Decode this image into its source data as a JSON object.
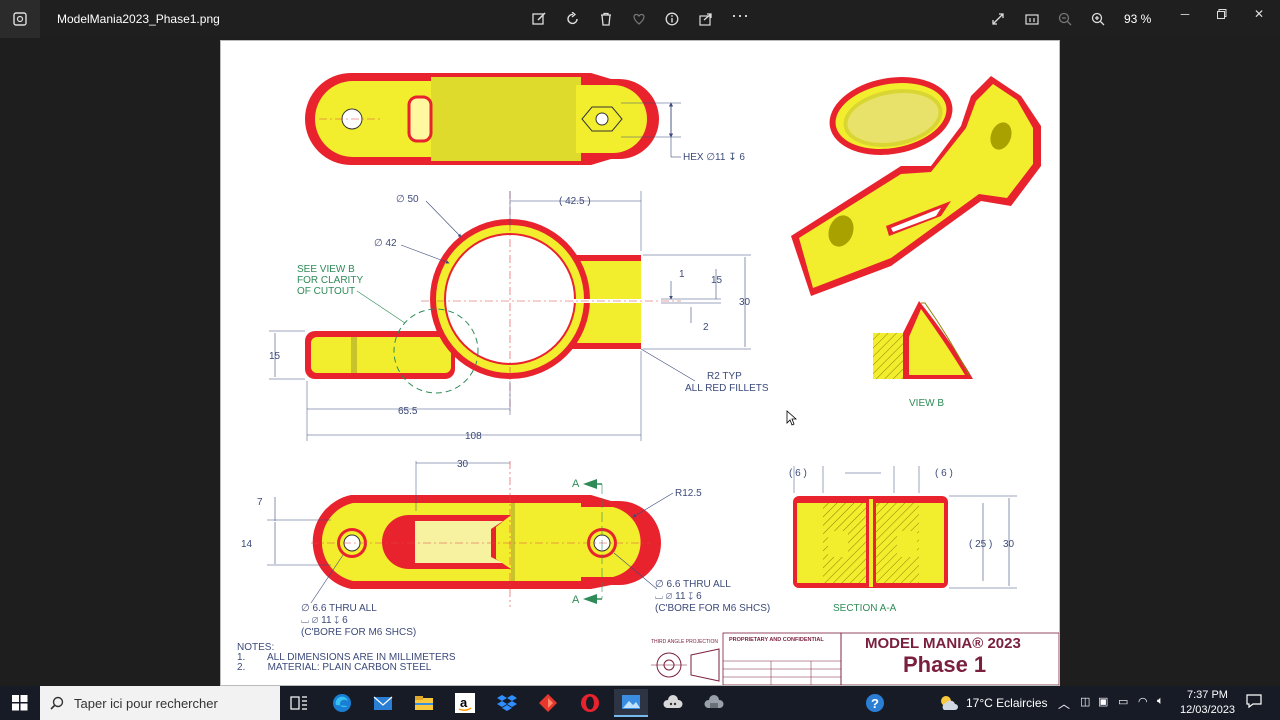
{
  "window": {
    "title": "ModelMania2023_Phase1.png",
    "zoom": "93 %",
    "toolbar_icons": [
      "edit-icon",
      "rotate-icon",
      "delete-icon",
      "favorite-icon",
      "info-icon",
      "share-icon",
      "more-icon"
    ],
    "right_icons": [
      "fullscreen-icon",
      "actual-size-icon",
      "zoom-out-icon",
      "zoom-in-icon"
    ]
  },
  "drawing": {
    "top_view": {
      "hex_label": "HEX ∅11 ↧ 6"
    },
    "front_view": {
      "d50": "∅ 50",
      "d42": "∅ 42",
      "d42_5": "( 42.5 )",
      "see_view_b": [
        "SEE VIEW B",
        "FOR CLARITY",
        "OF CUTOUT"
      ],
      "d1": "1",
      "d15_right": "15",
      "d30": "30",
      "d2": "2",
      "r2_typ": [
        "R2 TYP",
        "ALL RED FILLETS"
      ],
      "d15_left": "15",
      "d65_5": "65.5",
      "d108": "108"
    },
    "bottom_view": {
      "d30": "30",
      "d7": "7",
      "d14": "14",
      "r12_5": "R12.5",
      "section_a": "A",
      "right_hole": [
        "∅ 6.6 THRU ALL",
        "⌴  ∅ 11 ↧ 6",
        "(C'BORE FOR M6 SHCS)"
      ],
      "left_hole": [
        "∅ 6.6 THRU ALL",
        "⌴  ∅ 11 ↧ 6",
        "(C'BORE FOR M6 SHCS)"
      ]
    },
    "view_b_label": "VIEW B",
    "section": {
      "label": "SECTION A-A",
      "d6_left": "( 6 )",
      "d6_right": "( 6 )",
      "d25": "( 25 )",
      "d30": "30"
    },
    "notes": {
      "title": "NOTES:",
      "items": [
        "1.        ALL DIMENSIONS ARE IN MILLIMETERS",
        "2.        MATERIAL: PLAIN CARBON STEEL"
      ]
    },
    "title_block": {
      "projection": "THIRD ANGLE PROJECTION",
      "prop_conf": "PROPRIETARY AND CONFIDENTIAL",
      "title1": "MODEL MANIA® 2023",
      "title2": "Phase 1"
    }
  },
  "colors": {
    "yellow": "#f2ee2e",
    "red": "#e8232d",
    "dimension": "#3c4a7a",
    "note_green": "#2e8b57",
    "title": "#7a1f3d"
  },
  "taskbar": {
    "search_placeholder": "Taper ici pour rechercher",
    "apps": [
      "task-view-icon",
      "edge-icon",
      "mail-icon",
      "amazon-icon",
      "dropbox-icon",
      "app-red-icon",
      "opera-icon",
      "photos-icon",
      "app-cloud-icon",
      "app-gray-icon"
    ],
    "weather": "17°C  Eclaircies",
    "time": "7:37 PM",
    "date": "12/03/2023"
  }
}
